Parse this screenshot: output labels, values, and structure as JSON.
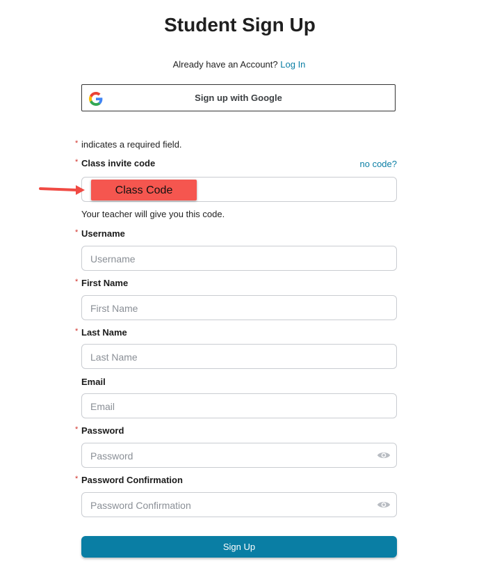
{
  "header": {
    "title": "Student Sign Up"
  },
  "login": {
    "prompt": "Already have an Account?",
    "link": "Log In"
  },
  "google": {
    "label": "Sign up with Google"
  },
  "required_note": {
    "star": "*",
    "text": "indicates a required field."
  },
  "class_code": {
    "label": "Class invite code",
    "no_code_link": "no code?",
    "helper": "Your teacher will give you this code.",
    "callout": "Class Code"
  },
  "fields": {
    "username": {
      "label": "Username",
      "placeholder": "Username"
    },
    "first_name": {
      "label": "First Name",
      "placeholder": "First Name"
    },
    "last_name": {
      "label": "Last Name",
      "placeholder": "Last Name"
    },
    "email": {
      "label": "Email",
      "placeholder": "Email"
    },
    "password": {
      "label": "Password",
      "placeholder": "Password"
    },
    "password_confirmation": {
      "label": "Password Confirmation",
      "placeholder": "Password Confirmation"
    }
  },
  "submit": {
    "label": "Sign Up"
  },
  "colors": {
    "accent": "#0a7ea4",
    "required": "#d0322b",
    "callout": "#f5564f",
    "arrow": "#f04a43"
  },
  "icons": {
    "google": "google-logo-icon",
    "eye": "eye-icon",
    "arrow": "arrow-right-icon"
  }
}
